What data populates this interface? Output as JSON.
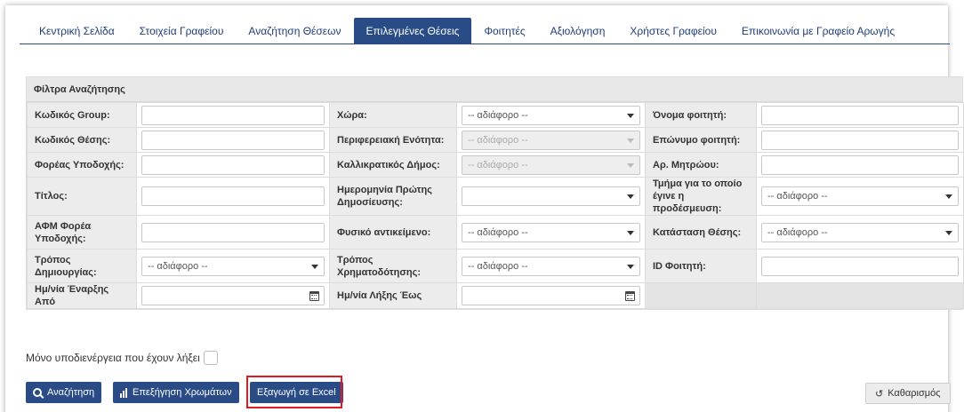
{
  "nav": {
    "items": [
      {
        "label": "Κεντρική Σελίδα"
      },
      {
        "label": "Στοιχεία Γραφείου"
      },
      {
        "label": "Αναζήτηση Θέσεων"
      },
      {
        "label": "Επιλεγμένες Θέσεις"
      },
      {
        "label": "Φοιτητές"
      },
      {
        "label": "Αξιολόγηση"
      },
      {
        "label": "Χρήστες Γραφείου"
      },
      {
        "label": "Επικοινωνία με Γραφείο Αρωγής"
      }
    ],
    "active_index": 3,
    "accent_color": "#2a4c86"
  },
  "filters": {
    "title": "Φίλτρα Αναζήτησης",
    "rows": [
      [
        {
          "label": "Κωδικός Group:",
          "type": "text",
          "value": ""
        },
        {
          "label": "Χώρα:",
          "type": "select",
          "value": "-- αδιάφορο --"
        },
        {
          "label": "Όνομα φοιτητή:",
          "type": "text",
          "value": ""
        }
      ],
      [
        {
          "label": "Κωδικός Θέσης:",
          "type": "text",
          "value": ""
        },
        {
          "label": "Περιφερειακή Ενότητα:",
          "type": "select-disabled",
          "value": "-- αδιάφορο --"
        },
        {
          "label": "Επώνυμο φοιτητή:",
          "type": "text",
          "value": ""
        }
      ],
      [
        {
          "label": "Φορέας Υποδοχής:",
          "type": "text",
          "value": ""
        },
        {
          "label": "Καλλικρατικός Δήμος:",
          "type": "select-disabled",
          "value": "-- αδιάφορο --"
        },
        {
          "label": "Αρ. Μητρώου:",
          "type": "text",
          "value": ""
        }
      ],
      [
        {
          "label": "Τίτλος:",
          "type": "text",
          "value": ""
        },
        {
          "label": "Ημερομηνία Πρώτης Δημοσίευσης:",
          "type": "select",
          "value": ""
        },
        {
          "label": "Τμήμα για το οποίο έγινε η προδέσμευση:",
          "type": "select",
          "value": "-- αδιάφορο --"
        }
      ],
      [
        {
          "label": "ΑΦΜ Φορέα Υποδοχής:",
          "type": "text",
          "value": ""
        },
        {
          "label": "Φυσικό αντικείμενο:",
          "type": "select",
          "value": "-- αδιάφορο --"
        },
        {
          "label": "Κατάσταση Θέσης:",
          "type": "select",
          "value": "-- αδιάφορο --"
        }
      ],
      [
        {
          "label": "Τρόπος Δημιουργίας:",
          "type": "select",
          "value": "-- αδιάφορο --"
        },
        {
          "label": "Τρόπος Χρηματοδότησης:",
          "type": "select",
          "value": "-- αδιάφορο --"
        },
        {
          "label": "ID Φοιτητή:",
          "type": "text",
          "value": ""
        }
      ],
      [
        {
          "label": "Ημ/νία Έναρξης Από",
          "type": "date",
          "value": ""
        },
        {
          "label": "Ημ/νία Λήξης Έως",
          "type": "date",
          "value": ""
        },
        {
          "label": "",
          "type": "empty",
          "value": ""
        }
      ]
    ]
  },
  "expired_checkbox": {
    "label": "Μόνο υποδιενέργεια που έχουν λήξει",
    "checked": false
  },
  "buttons": {
    "search": "Αναζήτηση",
    "colors_help": "Επεξήγηση Χρωμάτων",
    "export_excel": "Εξαγωγή σε Excel",
    "clear": "Καθαρισμός"
  },
  "icons": {
    "search": "search-icon",
    "bars": "bar-chart-icon",
    "calendar": "calendar-icon",
    "refresh": "refresh-icon",
    "caret": "chevron-down-icon"
  },
  "highlight_color": "#e01b24"
}
